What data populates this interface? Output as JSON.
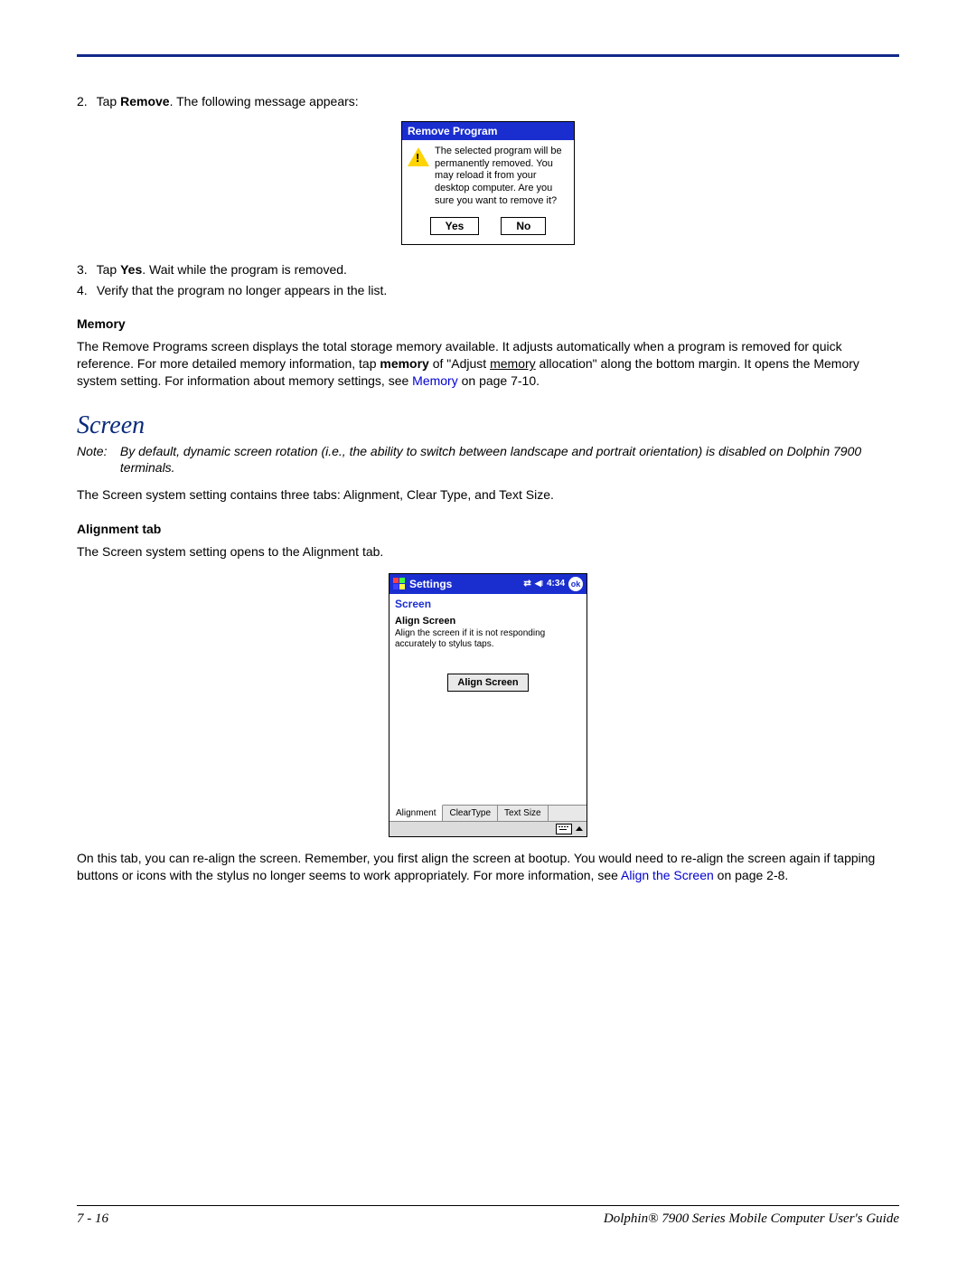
{
  "steps": {
    "s2_prefix": "2.",
    "s2_a": "Tap ",
    "s2_bold": "Remove",
    "s2_b": ". The following message appears:",
    "s3_prefix": "3.",
    "s3_a": "Tap ",
    "s3_bold": "Yes",
    "s3_b": ". Wait while the program is removed.",
    "s4_prefix": "4.",
    "s4": "Verify that the program no longer appears in the list."
  },
  "removeDialog": {
    "title": "Remove Program",
    "message": "The selected program will be permanently removed. You may reload it from your desktop computer. Are you sure you want to remove it?",
    "yes": "Yes",
    "no": "No"
  },
  "memory": {
    "heading": "Memory",
    "para_a": "The Remove Programs screen displays the total storage memory available. It adjusts automatically when a program is removed for quick reference. For more detailed memory information, tap ",
    "para_bold": "memory",
    "para_b": " of \"Adjust ",
    "para_underline": "memory",
    "para_c": " allocation\" along the bottom margin. It opens the Memory system setting. For information about memory settings, see ",
    "link": "Memory",
    "link_suffix": " on page 7-10."
  },
  "screen": {
    "heading": "Screen",
    "note_label": "Note:",
    "note_body": "By default, dynamic screen rotation (i.e., the ability to switch between landscape and portrait orientation) is disabled on Dolphin 7900 terminals.",
    "intro": "The Screen system setting contains three tabs: Alignment, Clear Type, and Text Size.",
    "alignment_heading": "Alignment tab",
    "alignment_intro": "The Screen system setting opens to the Alignment tab.",
    "after_a": "On this tab, you can re-align the screen. Remember, you first align the screen at bootup. You would need to re-align the screen again if tapping buttons or icons with the stylus no longer seems to work appropriately. For more information, see ",
    "after_link": "Align the Screen",
    "after_b": " on page 2-8."
  },
  "ppc": {
    "title": "Settings",
    "time": "4:34",
    "ok": "ok",
    "subhead": "Screen",
    "h3": "Align Screen",
    "desc": "Align the screen if it is not responding accurately to stylus taps.",
    "button": "Align Screen",
    "tabs": [
      "Alignment",
      "ClearType",
      "Text Size"
    ]
  },
  "footer": {
    "left": "7 - 16",
    "right": "Dolphin® 7900 Series Mobile Computer User's Guide"
  }
}
